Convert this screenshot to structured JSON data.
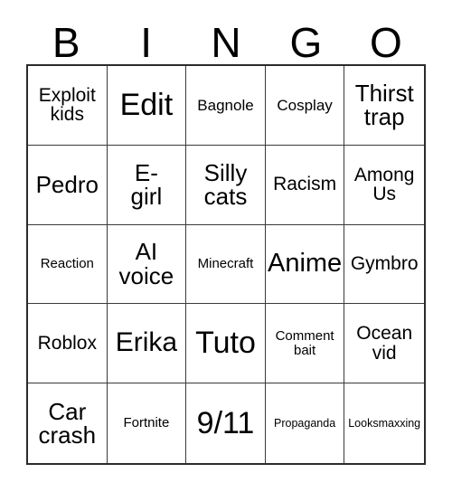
{
  "card": {
    "title": "Bingo Card",
    "header_letters": [
      "B",
      "I",
      "N",
      "G",
      "O"
    ],
    "colors": {
      "background": "#ffffff",
      "text": "#000000",
      "outer_border": "#2b2b2b",
      "inner_border": "#3a3a3a"
    },
    "grid": {
      "columns": 5,
      "rows": 5,
      "cells": [
        {
          "text": "Exploit\nkids",
          "size": "md"
        },
        {
          "text": "Edit",
          "size": "xxl"
        },
        {
          "text": "Bagnole",
          "size": "sm"
        },
        {
          "text": "Cosplay",
          "size": "sm"
        },
        {
          "text": "Thirst\ntrap",
          "size": "lg"
        },
        {
          "text": "Pedro",
          "size": "lg"
        },
        {
          "text": "E-\ngirl",
          "size": "lg"
        },
        {
          "text": "Silly\ncats",
          "size": "lg"
        },
        {
          "text": "Racism",
          "size": "md"
        },
        {
          "text": "Among\nUs",
          "size": "md"
        },
        {
          "text": "Reaction",
          "size": "xs"
        },
        {
          "text": "AI\nvoice",
          "size": "lg"
        },
        {
          "text": "Minecraft",
          "size": "xs"
        },
        {
          "text": "Anime",
          "size": "xl"
        },
        {
          "text": "Gymbro",
          "size": "md"
        },
        {
          "text": "Roblox",
          "size": "md"
        },
        {
          "text": "Erika",
          "size": "xl"
        },
        {
          "text": "Tuto",
          "size": "xxl"
        },
        {
          "text": "Comment\nbait",
          "size": "xs"
        },
        {
          "text": "Ocean\nvid",
          "size": "md"
        },
        {
          "text": "Car\ncrash",
          "size": "lg"
        },
        {
          "text": "Fortnite",
          "size": "xs"
        },
        {
          "text": "9/11",
          "size": "xxl"
        },
        {
          "text": "Propaganda",
          "size": "xxs"
        },
        {
          "text": "Looksmaxxing",
          "size": "xxs"
        }
      ]
    }
  }
}
